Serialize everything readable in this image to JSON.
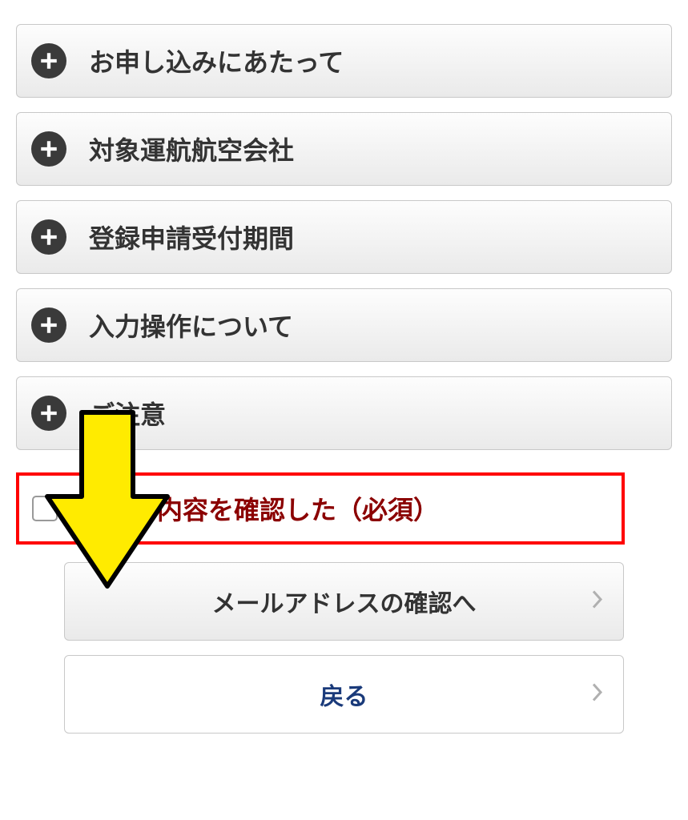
{
  "accordion": {
    "items": [
      {
        "label": "お申し込みにあたって"
      },
      {
        "label": "対象運航航空会社"
      },
      {
        "label": "登録申請受付期間"
      },
      {
        "label": "入力操作について"
      },
      {
        "label": "ご注意"
      }
    ]
  },
  "confirm": {
    "label": "以上の内容を確認した（必須）"
  },
  "buttons": {
    "next": "メールアドレスの確認へ",
    "back": "戻る"
  },
  "colors": {
    "highlight_border": "#ff0000",
    "confirm_text": "#8b0000",
    "arrow_fill": "#ffeb00",
    "arrow_stroke": "#000000",
    "back_text": "#1a3a7a"
  }
}
